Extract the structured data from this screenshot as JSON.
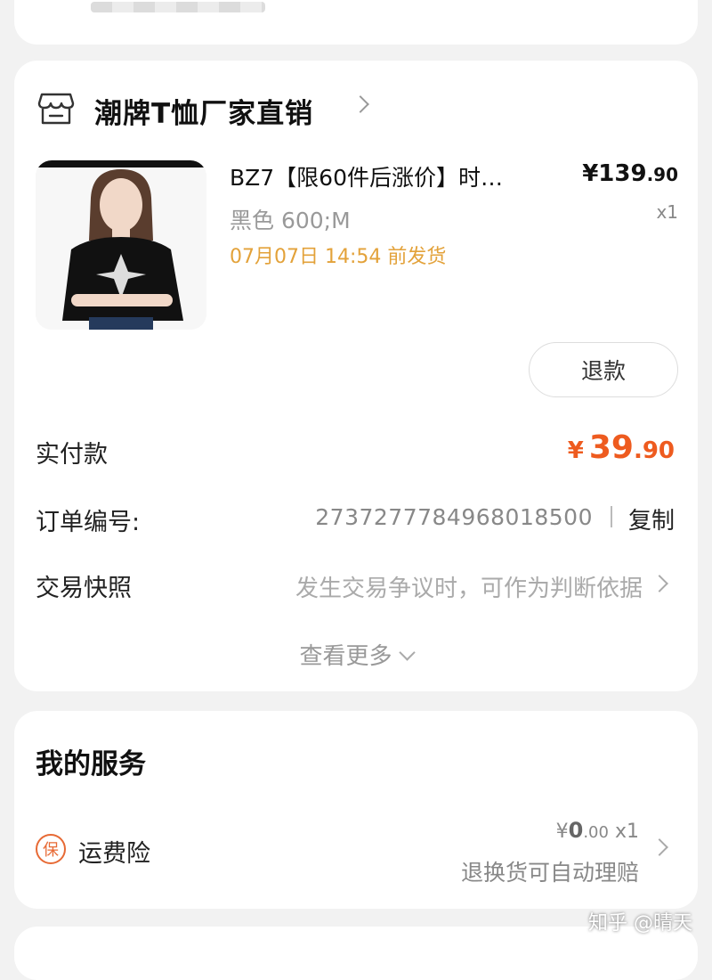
{
  "shop": {
    "name": "潮牌T恤厂家直销",
    "icon": "shop-icon"
  },
  "product": {
    "title": "BZ7【限60件后涨价】时…",
    "spec": "黑色 600;M",
    "ship_time": "07月07日 14:54 前发货",
    "price": {
      "currency": "¥",
      "int": "139",
      "dec": ".90"
    },
    "qty": "x1"
  },
  "actions": {
    "refund": "退款"
  },
  "order": {
    "paid_label": "实付款",
    "paid": {
      "currency": "¥",
      "int": "39",
      "dec": ".90"
    },
    "order_no_label": "订单编号:",
    "order_no": "2737277784968018500",
    "copy": "复制",
    "snapshot_label": "交易快照",
    "snapshot_desc": "发生交易争议时，可作为判断依据",
    "more": "查看更多"
  },
  "service": {
    "title": "我的服务",
    "badge": "保",
    "name": "运费险",
    "price": {
      "currency": "¥",
      "int": "0",
      "dec": ".00"
    },
    "qty": "x1",
    "desc": "退换货可自动理赔"
  },
  "watermark": "知乎 @晴天",
  "colors": {
    "accent": "#ee5b1f",
    "ship": "#e3a23a"
  }
}
